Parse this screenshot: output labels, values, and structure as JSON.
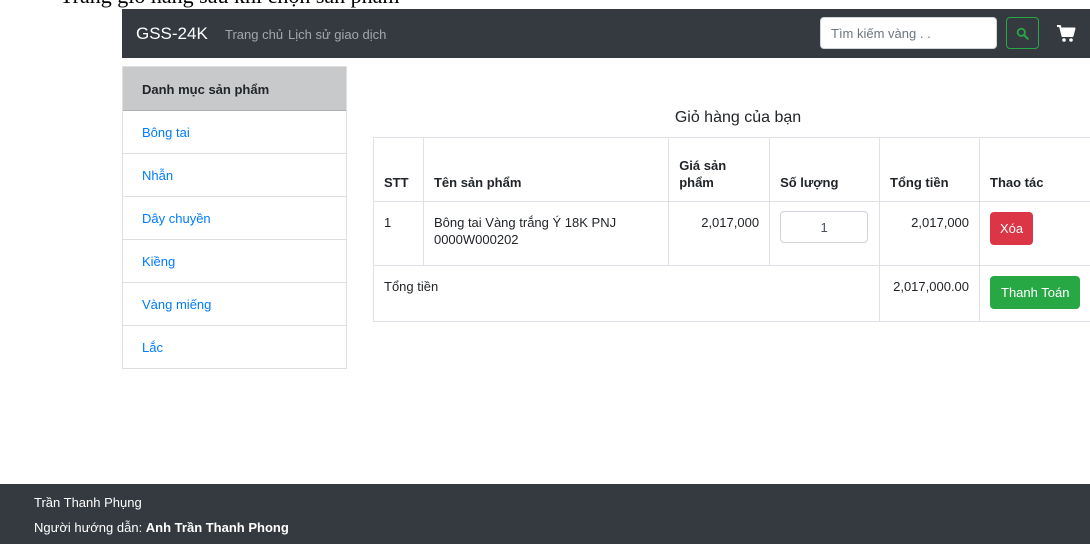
{
  "page_top_text": "Trang giỏ hàng sau khi chọn sản phẩm",
  "navbar": {
    "brand": "GSS-24K",
    "links": [
      "Trang chủ",
      "Lịch sử giao dịch"
    ],
    "search_placeholder": "Tìm kiếm vàng . .",
    "search_icon": "search-icon",
    "cart_icon": "cart-icon",
    "search_button_color": "#28a745"
  },
  "sidebar": {
    "header": "Danh mục sản phẩm",
    "items": [
      "Bông tai",
      "Nhẫn",
      "Dây chuyền",
      "Kiềng",
      "Vàng miếng",
      "Lắc"
    ]
  },
  "cart": {
    "title": "Giỏ hàng của bạn",
    "columns": [
      "STT",
      "Tên sản phẩm",
      "Giá sản phẩm",
      "Số lượng",
      "Tổng tiền",
      "Thao tác"
    ],
    "items": [
      {
        "stt": "1",
        "name": "Bông tai Vàng trắng Ý 18K PNJ 0000W000202",
        "price": "2,017,000",
        "quantity": "1",
        "total": "2,017,000",
        "action": "Xóa"
      }
    ],
    "total_label": "Tổng tiền",
    "total_value": "2,017,000.00",
    "pay_button": "Thanh Toán"
  },
  "footer": {
    "student": "Trần Thanh Phụng",
    "advisor_label": "Người hướng dẫn: ",
    "advisor_name": "Anh Trần Thanh Phong"
  },
  "colors": {
    "navbar": "#343a40",
    "link": "#007bff",
    "danger": "#dc3545",
    "success": "#28a745"
  }
}
